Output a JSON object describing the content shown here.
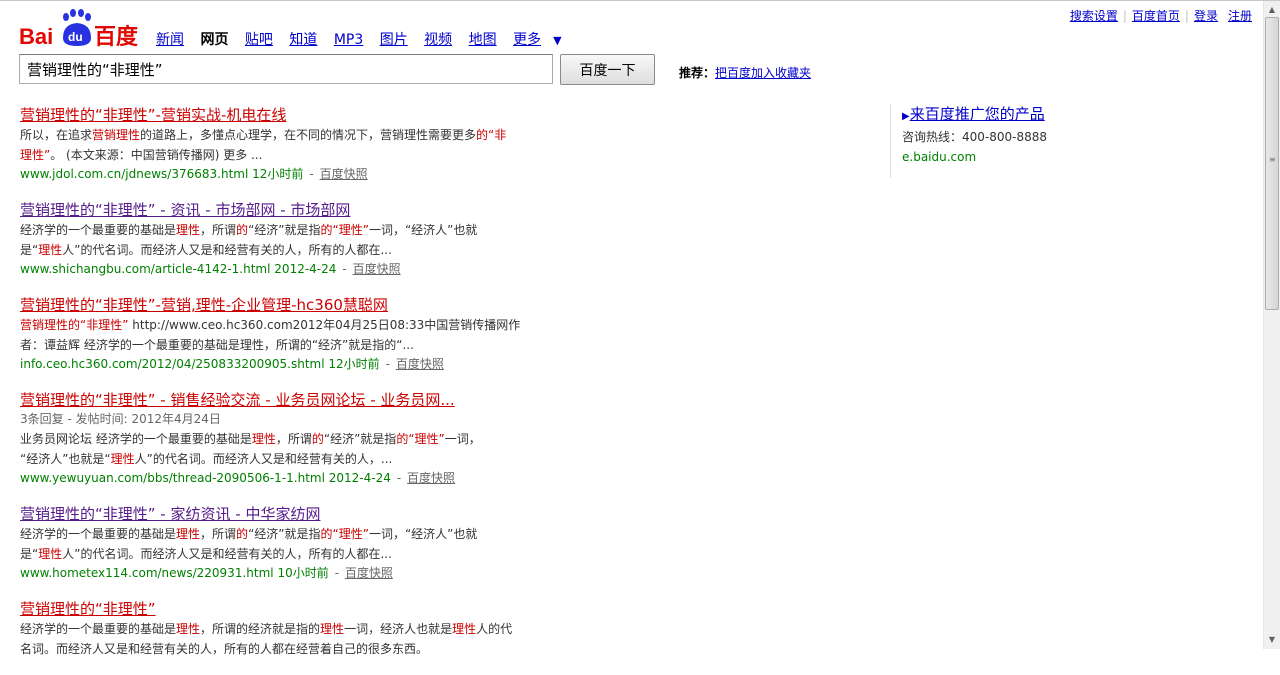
{
  "header": {
    "top_links": [
      "搜索设置",
      "百度首页",
      "登录",
      "注册"
    ],
    "logo_text": "百度",
    "nav": [
      {
        "label": "新闻",
        "active": false
      },
      {
        "label": "网页",
        "active": true
      },
      {
        "label": "贴吧",
        "active": false
      },
      {
        "label": "知道",
        "active": false
      },
      {
        "label": "MP3",
        "active": false
      },
      {
        "label": "图片",
        "active": false
      },
      {
        "label": "视频",
        "active": false
      },
      {
        "label": "地图",
        "active": false
      },
      {
        "label": "更多",
        "active": false
      }
    ]
  },
  "search": {
    "query": "营销理性的“非理性”",
    "button_label": "百度一下",
    "recommend_label": "推荐：",
    "recommend_link": "把百度加入收藏夹"
  },
  "results": [
    {
      "title": "营销理性的“非理性”-营销实战-机电在线",
      "visited": false,
      "snippet_lines": [
        [
          {
            "t": "所以，在追求"
          },
          {
            "t": "营销理性",
            "em": true
          },
          {
            "t": "的道路上，多懂点心理学，在不同的情况下，营销理性需要更多"
          },
          {
            "t": "的“非",
            "em": true
          }
        ],
        [
          {
            "t": "理性”",
            "em": true
          },
          {
            "t": "。 (本文来源：中国营销传播网) 更多 ..."
          }
        ]
      ],
      "url": "www.jdol.com.cn/jdnews/376683.html",
      "time": "12小时前",
      "cache": "百度快照"
    },
    {
      "title": "营销理性的“非理性” - 资讯 - 市场部网 - 市场部网",
      "visited": true,
      "snippet_lines": [
        [
          {
            "t": "经济学的一个最重要的基础是"
          },
          {
            "t": "理性",
            "em": true
          },
          {
            "t": "，所谓"
          },
          {
            "t": "的",
            "em": true
          },
          {
            "t": "“经济”就是指"
          },
          {
            "t": "的“理性”",
            "em": true
          },
          {
            "t": "一词，“经济人”也就"
          }
        ],
        [
          {
            "t": "是“"
          },
          {
            "t": "理性",
            "em": true
          },
          {
            "t": "人”的代名词。而经济人又是和经营有关的人，所有的人都在..."
          }
        ]
      ],
      "url": "www.shichangbu.com/article-4142-1.html",
      "time": "2012-4-24",
      "cache": "百度快照"
    },
    {
      "title": "营销理性的“非理性”-营销,理性-企业管理-hc360慧聪网",
      "visited": false,
      "alt_suffix": "慧聪网",
      "snippet_lines": [
        [
          {
            "t": "营销理性的“非理性”",
            "em": true
          },
          {
            "t": " http://www.ceo.hc360.com2012年04月25日08:33中国营销传播网作"
          }
        ],
        [
          {
            "t": "者：谭益辉  经济学的一个最重要的基础是理性，所谓的“经济”就是指的“..."
          }
        ]
      ],
      "url": "info.ceo.hc360.com/2012/04/250833200905.shtml",
      "time": "12小时前",
      "cache": "百度快照"
    },
    {
      "title": "营销理性的“非理性” - 销售经验交流 - 业务员网论坛 - 业务员网...",
      "visited": false,
      "meta": "3条回复 - 发帖时间: 2012年4月24日",
      "snippet_lines": [
        [
          {
            "t": "业务员网论坛  经济学的一个最重要的基础是"
          },
          {
            "t": "理性",
            "em": true
          },
          {
            "t": "，所谓"
          },
          {
            "t": "的",
            "em": true
          },
          {
            "t": "“经济”就是指"
          },
          {
            "t": "的“理性”",
            "em": true
          },
          {
            "t": "一词，"
          }
        ],
        [
          {
            "t": "“经济人”也就是“"
          },
          {
            "t": "理性",
            "em": true
          },
          {
            "t": "人”的代名词。而经济人又是和经营有关的人，..."
          }
        ]
      ],
      "url": "www.yewuyuan.com/bbs/thread-2090506-1-1.html",
      "time": "2012-4-24",
      "cache": "百度快照"
    },
    {
      "title": "营销理性的“非理性” - 家纺资讯 - 中华家纺网",
      "visited": true,
      "snippet_lines": [
        [
          {
            "t": "经济学的一个最重要的基础是"
          },
          {
            "t": "理性",
            "em": true
          },
          {
            "t": "，所谓"
          },
          {
            "t": "的",
            "em": true
          },
          {
            "t": "“经济”就是指"
          },
          {
            "t": "的“理性”",
            "em": true
          },
          {
            "t": "一词，“经济人”也就"
          }
        ],
        [
          {
            "t": "是“"
          },
          {
            "t": "理性",
            "em": true
          },
          {
            "t": "人”的代名词。而经济人又是和经营有关的人，所有的人都在..."
          }
        ]
      ],
      "url": "www.hometex114.com/news/220931.html",
      "time": "10小时前",
      "cache": "百度快照"
    },
    {
      "title": "营销理性的“非理性”",
      "visited": false,
      "snippet_lines": [
        [
          {
            "t": "经济学的一个最重要的基础是"
          },
          {
            "t": "理性",
            "em": true
          },
          {
            "t": "，所谓的经济就是指的"
          },
          {
            "t": "理性",
            "em": true
          },
          {
            "t": "一词，经济人也就是"
          },
          {
            "t": "理性",
            "em": true
          },
          {
            "t": "人的代"
          }
        ],
        [
          {
            "t": "名词。而经济人又是和经营有关的人，所有的人都在经营着自己的很多东西。"
          }
        ]
      ]
    }
  ],
  "ad": {
    "title": "来百度推广您的产品",
    "hotline": "咨询热线：400-800-8888",
    "url": "e.baidu.com"
  },
  "colors": {
    "link": "#0000cc",
    "title_red": "#cc0000",
    "visited": "#551a8b",
    "url_green": "#008000",
    "logo_red": "#e10602",
    "logo_blue": "#2932e1"
  }
}
